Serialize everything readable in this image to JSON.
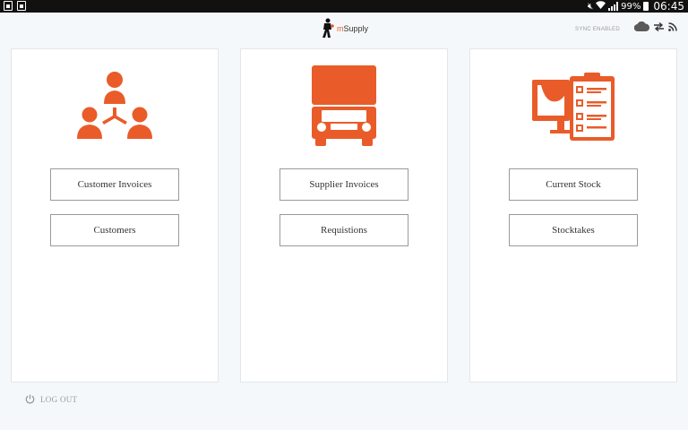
{
  "status_bar": {
    "battery": "99%",
    "time": "06:45"
  },
  "header": {
    "logo_prefix": "m",
    "logo_suffix": "Supply",
    "sync_status": "SYNC ENABLED",
    "icons": [
      "cloud-icon",
      "sync-arrows-icon",
      "rss-icon"
    ]
  },
  "panels": [
    {
      "id": "customers",
      "icon": "customers-network-icon",
      "buttons": [
        "Customer Invoices",
        "Customers"
      ]
    },
    {
      "id": "suppliers",
      "icon": "truck-icon",
      "buttons": [
        "Supplier Invoices",
        "Requistions"
      ]
    },
    {
      "id": "stock",
      "icon": "stock-clipboard-icon",
      "buttons": [
        "Current Stock",
        "Stocktakes"
      ]
    }
  ],
  "footer": {
    "logout_label": "LOG OUT"
  },
  "colors": {
    "accent": "#e95c29",
    "background": "#f5f8fb",
    "status_bar": "#111111",
    "button_border": "#9a9a9a"
  }
}
